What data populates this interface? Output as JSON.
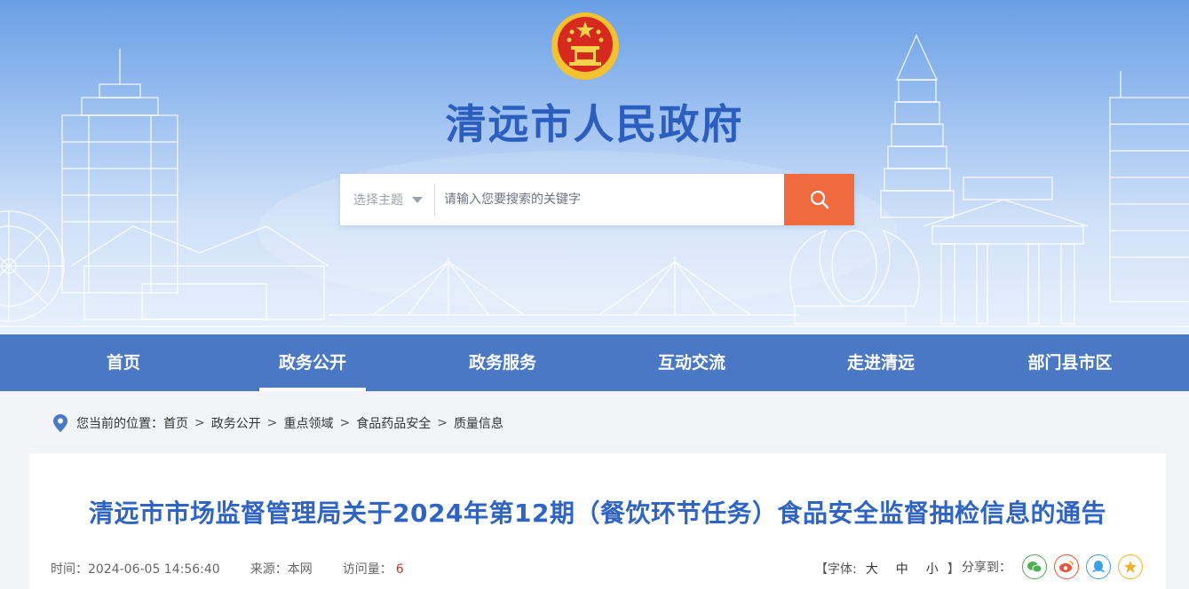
{
  "site": {
    "title": "清远市人民政府"
  },
  "search": {
    "topic_placeholder": "选择主题",
    "placeholder": "请输入您要搜索的关键字"
  },
  "nav": {
    "items": [
      {
        "label": "首页"
      },
      {
        "label": "政务公开",
        "active": true
      },
      {
        "label": "政务服务"
      },
      {
        "label": "互动交流"
      },
      {
        "label": "走进清远"
      },
      {
        "label": "部门县市区"
      }
    ]
  },
  "breadcrumb": {
    "prefix": "您当前的位置：",
    "items": [
      "首页",
      "政务公开",
      "重点领域",
      "食品药品安全",
      "质量信息"
    ],
    "separator": ">"
  },
  "article": {
    "title": "清远市市场监督管理局关于2024年第12期（餐饮环节任务）食品安全监督抽检信息的通告",
    "time_label": "时间：",
    "time": "2024-06-05 14:56:40",
    "source_label": "来源：",
    "source": "本网",
    "visits_label": "访问量：",
    "visits": "6"
  },
  "font_size": {
    "label": "【字体:",
    "large": "大",
    "medium": "中",
    "small": "小",
    "close": "】"
  },
  "share": {
    "label": "分享到：",
    "icons": [
      "wechat-icon",
      "weibo-icon",
      "qq-icon",
      "qzone-icon"
    ]
  },
  "colors": {
    "nav_bg": "#4b78c5",
    "title_blue": "#2f64c3",
    "search_btn": "#ef6a3f",
    "visits_red": "#c0392b"
  }
}
